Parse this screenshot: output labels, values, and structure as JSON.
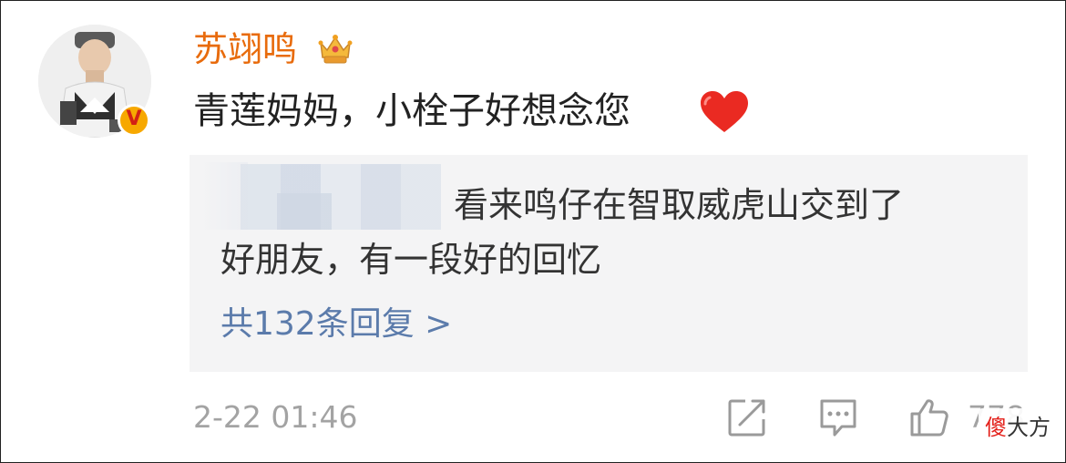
{
  "comment": {
    "username": "苏翊鸣",
    "text": "青莲妈妈，小栓子好想念您",
    "verified_badge": "V",
    "colors": {
      "username": "#e86b0c",
      "badge": "#f7a800",
      "heart": "#ea2a22"
    },
    "icons": {
      "crown": "crown-icon",
      "heart": "heart-emoji"
    }
  },
  "quoted_reply": {
    "line1": "看来鸣仔在智取威虎山交到了",
    "line2": "好朋友，有一段好的回忆",
    "reply_link": "共132条回复 >"
  },
  "footer": {
    "timestamp": "2-22 01:46",
    "like_count": "778",
    "icons": [
      "share-icon",
      "comment-icon",
      "like-icon"
    ]
  },
  "watermark": {
    "accent": "傻",
    "rest": "大方"
  }
}
